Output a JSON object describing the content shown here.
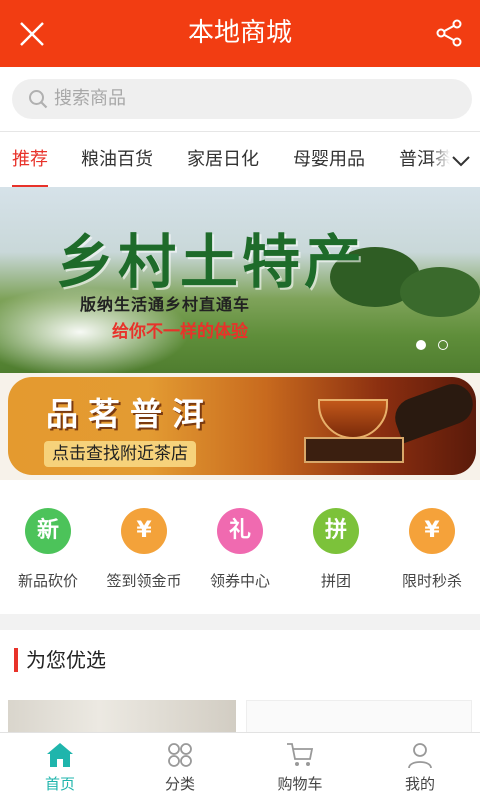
{
  "header": {
    "title": "本地商城",
    "close_icon": "close-icon",
    "share_icon": "share-icon",
    "bg": "#f23d12"
  },
  "search": {
    "placeholder": "搜索商品"
  },
  "tabs": [
    {
      "label": "推荐",
      "active": true
    },
    {
      "label": "粮油百货",
      "active": false
    },
    {
      "label": "家居日化",
      "active": false
    },
    {
      "label": "母婴用品",
      "active": false
    },
    {
      "label": "普洱茶",
      "active": false
    }
  ],
  "banner": {
    "headline": "乡村土特产",
    "line1": "版纳生活通乡村直通车",
    "line2": "给你不一样的体验",
    "slides": 2,
    "active_slide": 1
  },
  "promo": {
    "title": "品茗普洱",
    "subtitle": "点击查找附近茶店"
  },
  "quick_entries": [
    {
      "label": "新品砍价",
      "icon": "new-badge-icon",
      "glyph": "新",
      "color": "#4cc35a"
    },
    {
      "label": "签到领金币",
      "icon": "gold-coin-icon",
      "glyph": "¥",
      "color": "#f3a23a"
    },
    {
      "label": "领券中心",
      "icon": "gift-coupon-icon",
      "glyph": "礼",
      "color": "#f06ab0"
    },
    {
      "label": "拼团",
      "icon": "group-buy-icon",
      "glyph": "拼",
      "color": "#7cc23a"
    },
    {
      "label": "限时秒杀",
      "icon": "stopwatch-icon",
      "glyph": "¥",
      "color": "#f5a23a"
    }
  ],
  "section": {
    "title": "为您优选"
  },
  "bottom_nav": [
    {
      "label": "首页",
      "icon": "home-icon",
      "active": true
    },
    {
      "label": "分类",
      "icon": "category-icon",
      "active": false
    },
    {
      "label": "购物车",
      "icon": "cart-icon",
      "active": false
    },
    {
      "label": "我的",
      "icon": "user-icon",
      "active": false
    }
  ],
  "colors": {
    "accent": "#e8322a",
    "nav_active": "#1fb5ac"
  }
}
